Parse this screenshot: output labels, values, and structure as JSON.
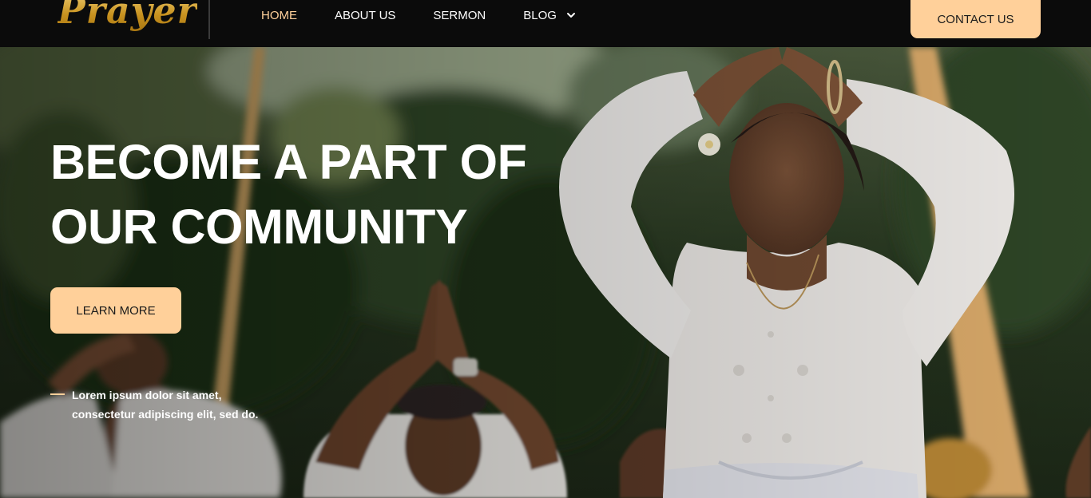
{
  "header": {
    "logo_text": "Prayer",
    "nav": [
      {
        "label": "HOME",
        "active": true
      },
      {
        "label": "ABOUT US",
        "active": false
      },
      {
        "label": "SERMON",
        "active": false
      },
      {
        "label": "BLOG",
        "active": false,
        "icon": "chevron-down-icon"
      }
    ],
    "contact_label": "CONTACT US"
  },
  "hero": {
    "title_line1": "BECOME A PART OF",
    "title_line2": "OUR COMMUNITY",
    "cta_label": "LEARN MORE",
    "tagline": "Lorem ipsum dolor sit amet, consectetur adipiscing elit, sed do.",
    "photo_description": "people praying outdoors with hands raised together"
  },
  "colors": {
    "accent": "#ffd09a",
    "header_bg": "#0b0b0b",
    "logo_gold": "#d8a93a",
    "text_light": "#ffffff",
    "button_text": "#1b1b1b"
  }
}
